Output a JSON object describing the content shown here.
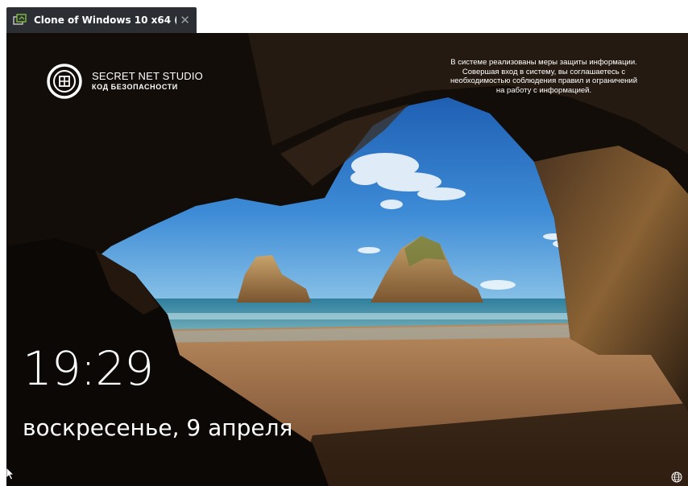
{
  "window": {
    "tab_title": "Clone of Windows 10 x64 (...",
    "tab_icon": "vm-icon",
    "close_icon": "close-icon"
  },
  "brand": {
    "name": "SECRET NET STUDIO",
    "subtitle": "КОД БЕЗОПАСНОСТИ",
    "logo_icon": "secret-net-logo-icon"
  },
  "notice": {
    "lines": [
      "В системе реализованы меры защиты информации.",
      "Совершая вход в систему, вы соглашаетесь с",
      "необходимостью соблюдения правил и ограничений",
      "на работу с информацией."
    ]
  },
  "lock_screen": {
    "time": "19:29",
    "date": "воскресенье, 9 апреля"
  },
  "status": {
    "network_icon": "globe-icon",
    "pointer_icon": "mouse-cursor-icon"
  },
  "colors": {
    "tab_background": "#2b2f34",
    "text": "#ffffff",
    "sky": "#2f78c9",
    "sea": "#3f8fa6",
    "sand": "#a9774a",
    "cave": "#120d08"
  }
}
